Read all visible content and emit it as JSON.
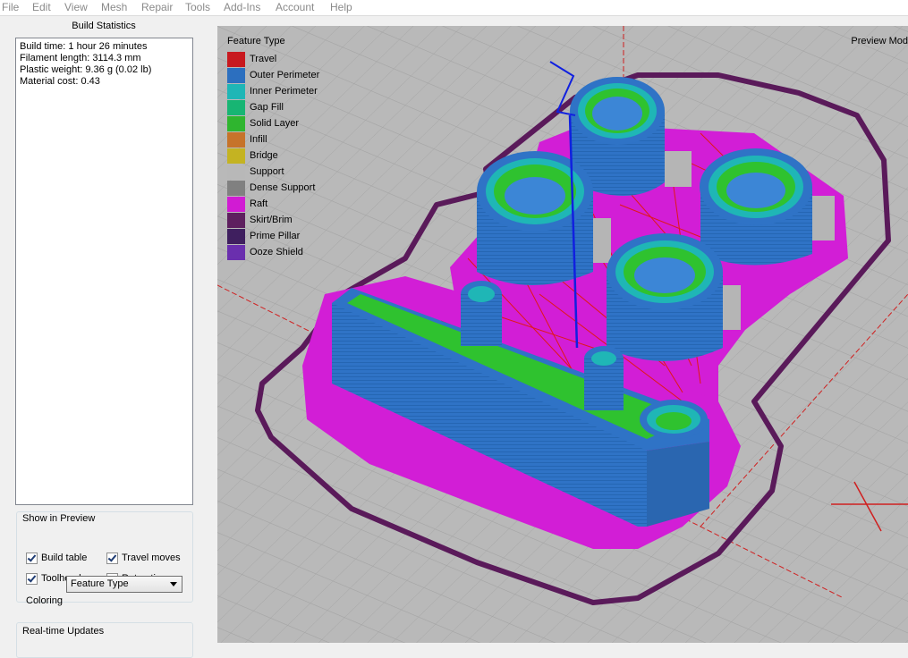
{
  "menu": [
    "File",
    "Edit",
    "View",
    "Mesh",
    "Repair",
    "Tools",
    "Add-Ins",
    "Account",
    "Help"
  ],
  "stats": {
    "title": "Build Statistics",
    "lines": [
      "Build time: 1 hour 26 minutes",
      "Filament length: 3114.3 mm",
      "Plastic weight: 9.36 g (0.02 lb)",
      "Material cost: 0.43"
    ]
  },
  "show_in_preview": {
    "title": "Show in Preview",
    "build_table": {
      "label": "Build table",
      "checked": true
    },
    "travel_moves": {
      "label": "Travel moves",
      "checked": true
    },
    "toolhead": {
      "label": "Toolhead",
      "checked": true
    },
    "retractions": {
      "label": "Retractions",
      "checked": false
    },
    "coloring_label": "Coloring",
    "coloring_value": "Feature Type"
  },
  "realtime_updates": {
    "title": "Real-time Updates"
  },
  "viewport": {
    "legend_title": "Feature Type",
    "preview_mode": "Preview Mod",
    "legend": [
      {
        "label": "Travel",
        "color": "#c8191f"
      },
      {
        "label": "Outer Perimeter",
        "color": "#2c6fbf"
      },
      {
        "label": "Inner Perimeter",
        "color": "#1fb6b6"
      },
      {
        "label": "Gap Fill",
        "color": "#17b573"
      },
      {
        "label": "Solid Layer",
        "color": "#2fb52f"
      },
      {
        "label": "Infill",
        "color": "#c6732a"
      },
      {
        "label": "Bridge",
        "color": "#c4b322"
      },
      {
        "label": "Support",
        "color": "#b8b8b8"
      },
      {
        "label": "Dense Support",
        "color": "#808080"
      },
      {
        "label": "Raft",
        "color": "#d11bd3"
      },
      {
        "label": "Skirt/Brim",
        "color": "#5e1f5f"
      },
      {
        "label": "Prime Pillar",
        "color": "#3f1f5f"
      },
      {
        "label": "Ooze Shield",
        "color": "#6a2fae"
      }
    ]
  }
}
